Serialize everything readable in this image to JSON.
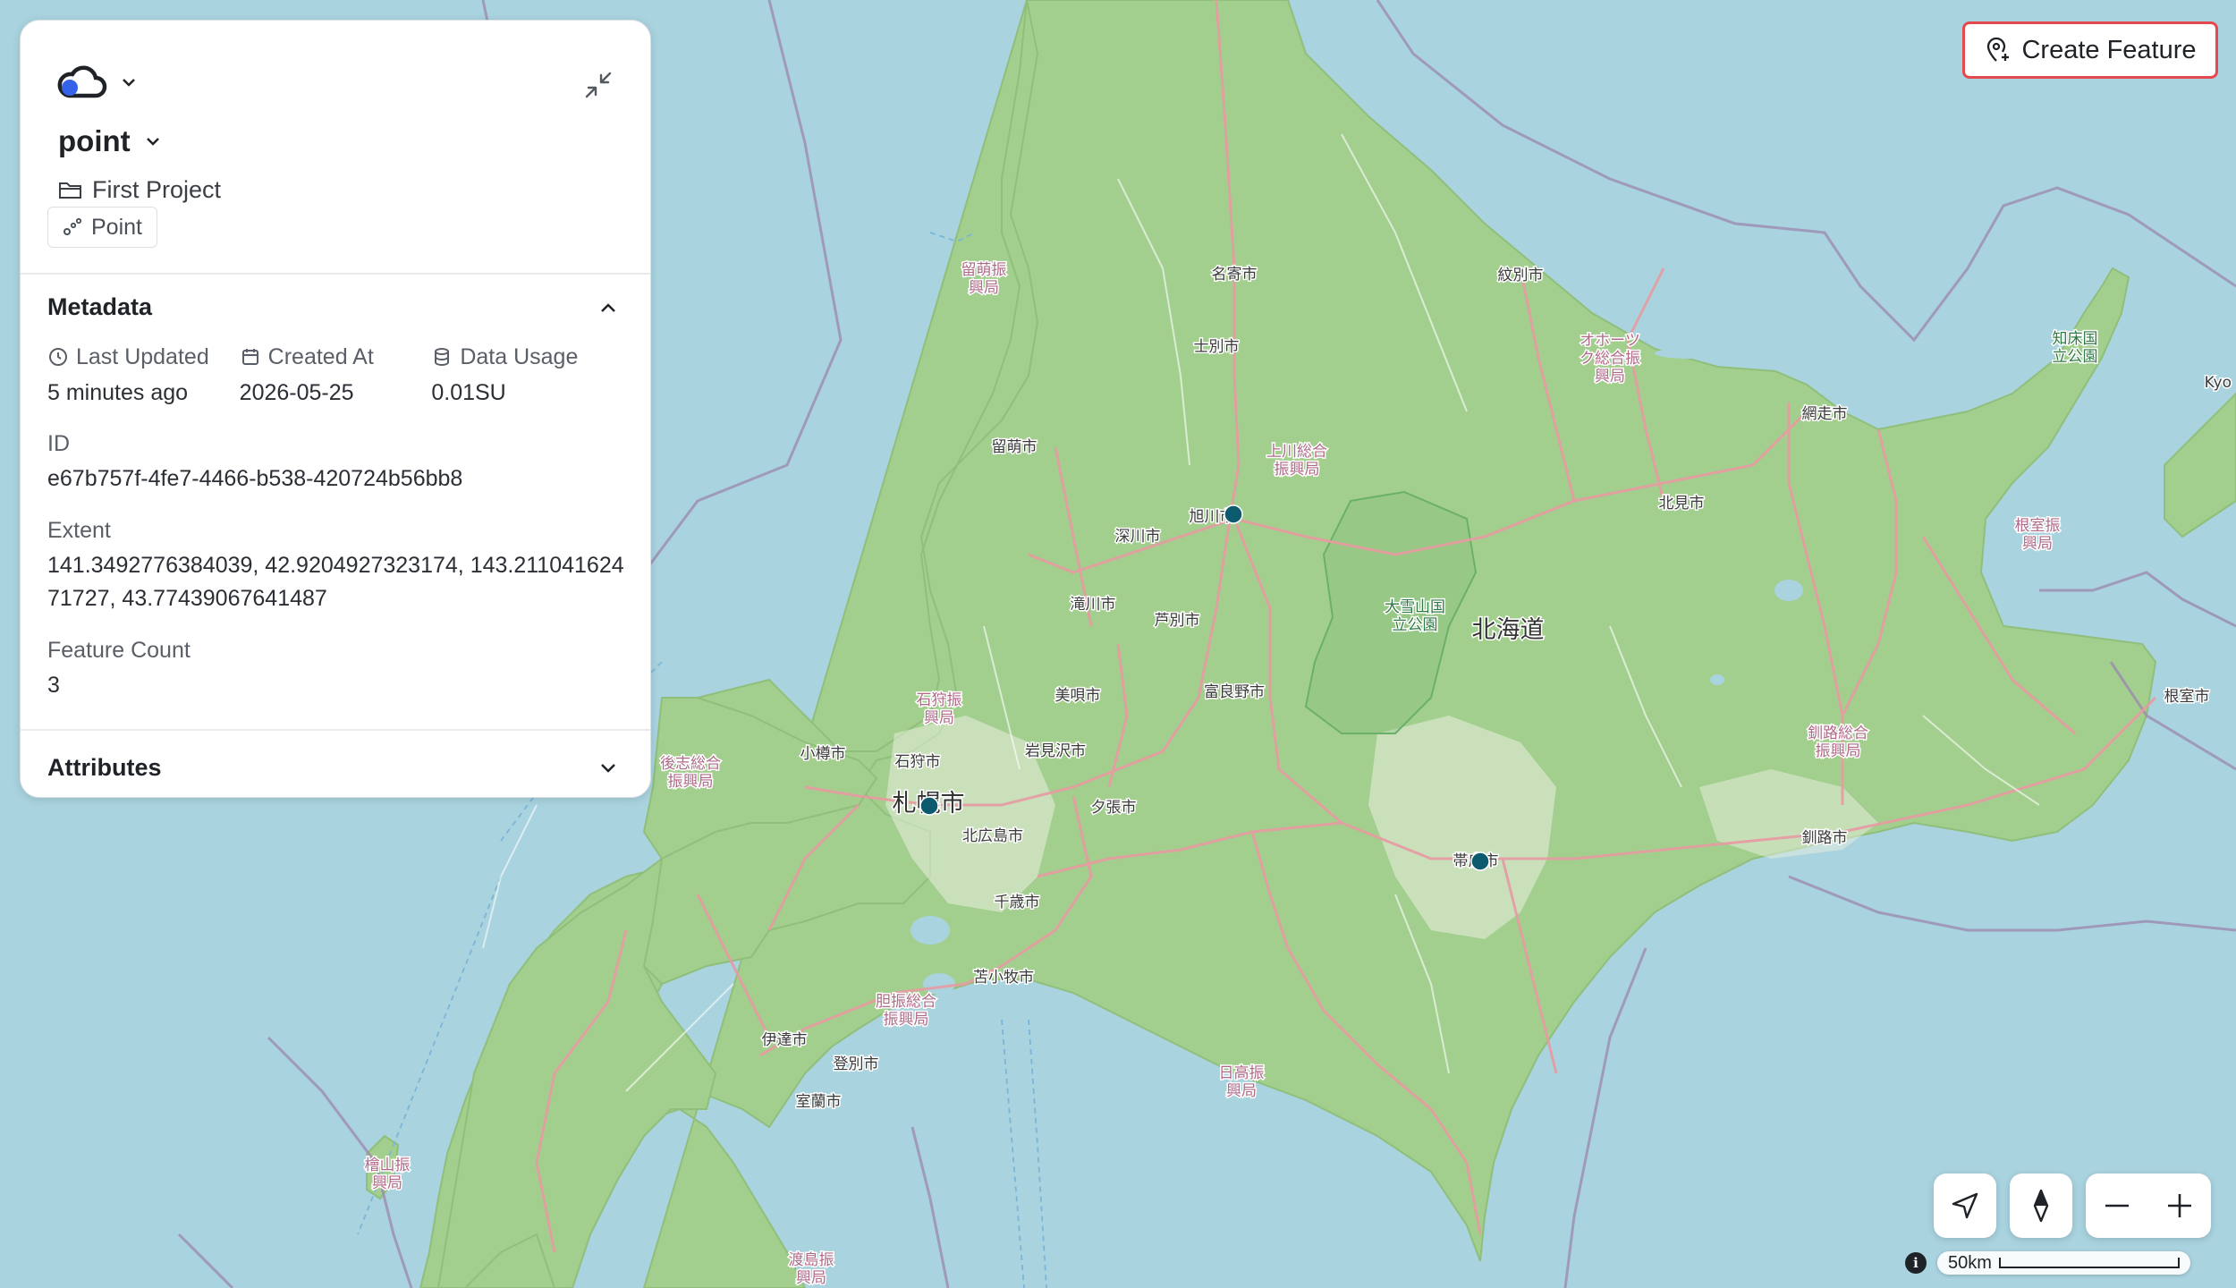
{
  "panel": {
    "layer_name": "point",
    "project": "First Project",
    "geometry_type": "Point",
    "metadata": {
      "title": "Metadata",
      "last_updated_label": "Last Updated",
      "last_updated_value": "5 minutes ago",
      "created_at_label": "Created At",
      "created_at_value": "2026-05-25",
      "data_usage_label": "Data Usage",
      "data_usage_value": "0.01SU",
      "id_label": "ID",
      "id_value": "e67b757f-4fe7-4466-b538-420724b56bb8",
      "extent_label": "Extent",
      "extent_value": "141.3492776384039, 42.9204927323174, 143.21104162471727, 43.77439067641487",
      "feature_count_label": "Feature Count",
      "feature_count_value": "3"
    },
    "attributes_title": "Attributes"
  },
  "toolbar": {
    "create_feature_label": "Create Feature"
  },
  "map": {
    "scale_label": "50km",
    "labels": [
      {
        "name": "name-nayoro",
        "text": "名寄市"
      },
      {
        "name": "name-monbetsu",
        "text": "紋別市"
      },
      {
        "name": "name-shibetsu",
        "text": "士別市"
      },
      {
        "name": "name-rumoi-sub",
        "text": "留萌振興局"
      },
      {
        "name": "name-rumoi",
        "text": "留萌市"
      },
      {
        "name": "name-kamikawa-sub",
        "text": "上川総合振興局"
      },
      {
        "name": "name-asahikawa",
        "text": "旭川市"
      },
      {
        "name": "name-fukagawa",
        "text": "深川市"
      },
      {
        "name": "name-takikawa",
        "text": "滝川市"
      },
      {
        "name": "name-ashibetsu",
        "text": "芦別市"
      },
      {
        "name": "name-okhotsk-sub",
        "text": "オホーツク総合振興局"
      },
      {
        "name": "name-abashiri",
        "text": "網走市"
      },
      {
        "name": "name-kitami",
        "text": "北見市"
      },
      {
        "name": "name-shiretoko",
        "text": "知床国立公園"
      },
      {
        "name": "name-nemuro-sub",
        "text": "根室振興局"
      },
      {
        "name": "name-daisetsuzan",
        "text": "大雪山国立公園"
      },
      {
        "name": "name-hokkaido",
        "text": "北海道"
      },
      {
        "name": "name-furano",
        "text": "富良野市"
      },
      {
        "name": "name-bibai",
        "text": "美唄市"
      },
      {
        "name": "name-ishikari-sub",
        "text": "石狩振興局"
      },
      {
        "name": "name-otaru",
        "text": "小樽市"
      },
      {
        "name": "name-ishikari",
        "text": "石狩市"
      },
      {
        "name": "name-iwamizawa",
        "text": "岩見沢市"
      },
      {
        "name": "name-shiribeshi-sub",
        "text": "後志総合振興局"
      },
      {
        "name": "name-sapporo",
        "text": "札幌市"
      },
      {
        "name": "name-yubari",
        "text": "夕張市"
      },
      {
        "name": "name-kitahiroshima",
        "text": "北広島市"
      },
      {
        "name": "name-chitose",
        "text": "千歳市"
      },
      {
        "name": "name-obihiro",
        "text": "帯広市"
      },
      {
        "name": "name-kushiro-sub",
        "text": "釧路総合振興局"
      },
      {
        "name": "name-kushiro",
        "text": "釧路市"
      },
      {
        "name": "name-nemuro",
        "text": "根室市"
      },
      {
        "name": "name-tomakomai",
        "text": "苫小牧市"
      },
      {
        "name": "name-iburi-sub",
        "text": "胆振総合振興局"
      },
      {
        "name": "name-date",
        "text": "伊達市"
      },
      {
        "name": "name-noboribetsu",
        "text": "登別市"
      },
      {
        "name": "name-muroran",
        "text": "室蘭市"
      },
      {
        "name": "name-hidaka-sub",
        "text": "日高振興局"
      },
      {
        "name": "name-hiyama-sub",
        "text": "檜山振興局"
      },
      {
        "name": "name-oshima-sub",
        "text": "渡島振興局"
      },
      {
        "name": "name-kyo",
        "text": "Kyo"
      }
    ]
  }
}
